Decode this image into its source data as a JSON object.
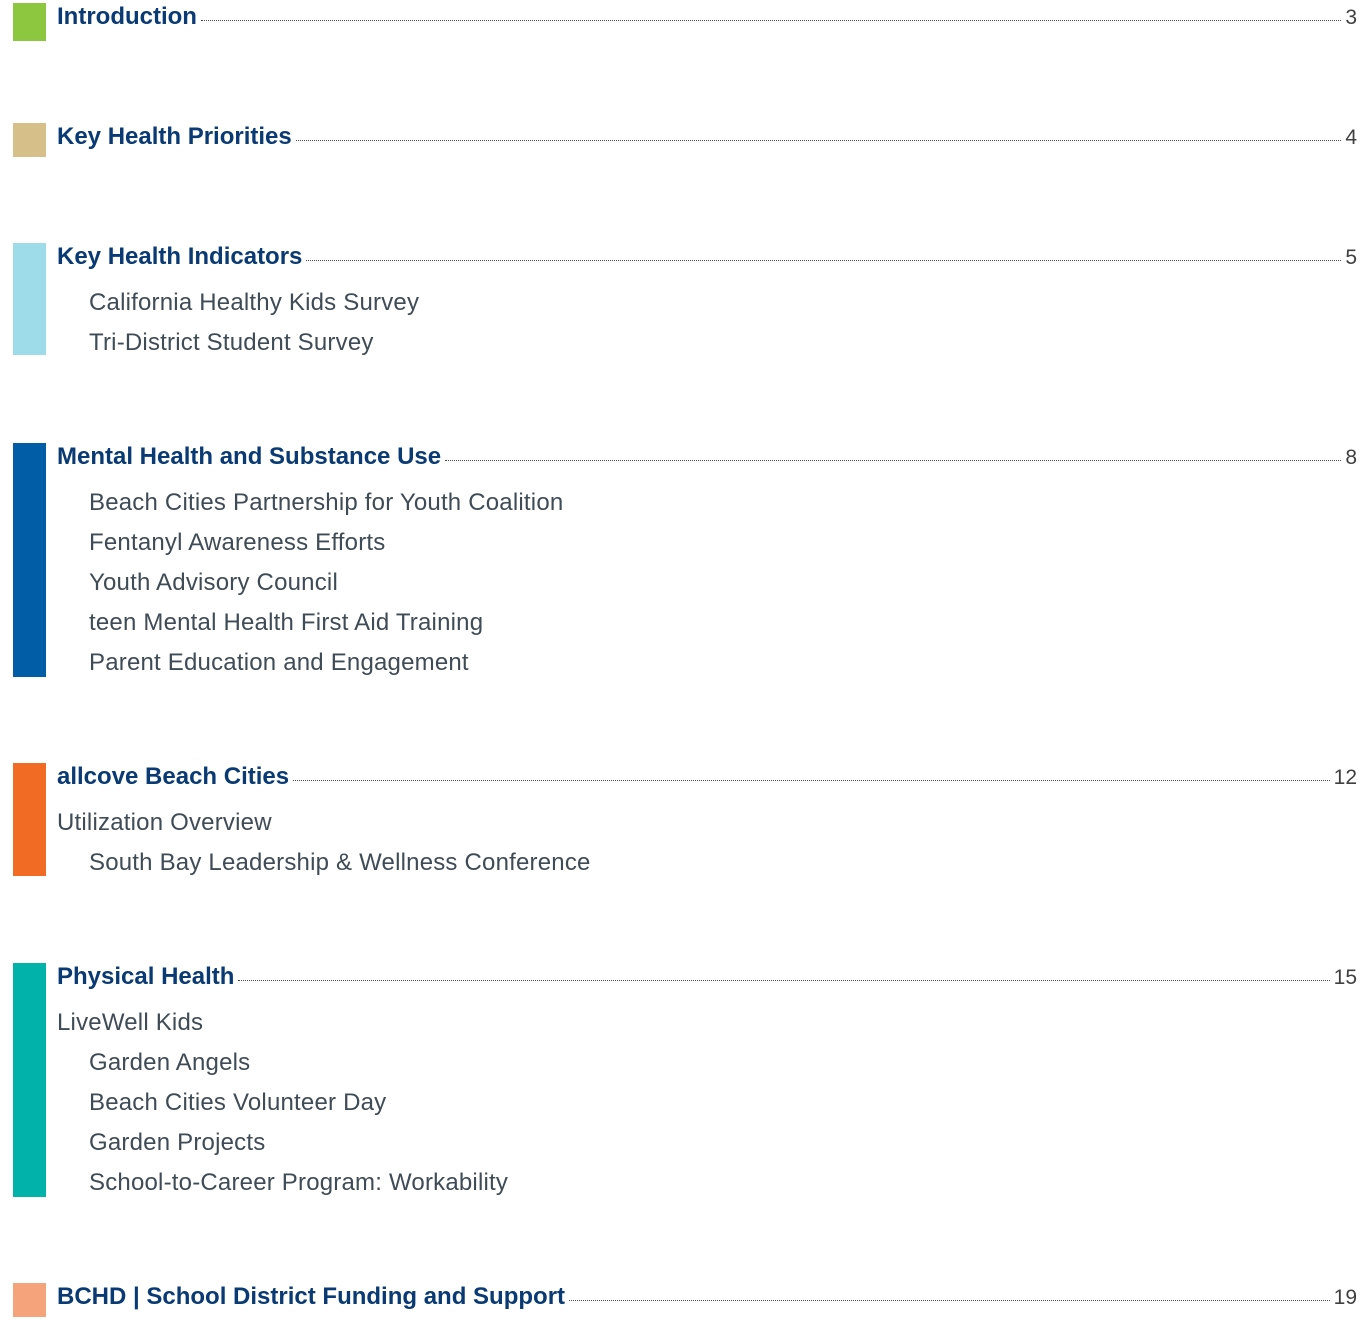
{
  "toc": {
    "sections": [
      {
        "title": "Introduction",
        "page": "3",
        "color": "#8dc63f",
        "items": []
      },
      {
        "title": "Key Health Priorities",
        "page": "4",
        "color": "#d7bf8a",
        "items": []
      },
      {
        "title": "Key Health Indicators",
        "page": "5",
        "color": "#9fdcea",
        "items": [
          {
            "label": "California Healthy Kids Survey",
            "indent": true
          },
          {
            "label": "Tri-District Student Survey",
            "indent": true
          }
        ]
      },
      {
        "title": "Mental Health and Substance Use",
        "page": "8",
        "color": "#005da6",
        "items": [
          {
            "label": "Beach Cities Partnership for Youth Coalition",
            "indent": true
          },
          {
            "label": "Fentanyl Awareness Efforts",
            "indent": true
          },
          {
            "label": "Youth Advisory Council",
            "indent": true
          },
          {
            "label": "teen Mental Health First Aid Training",
            "indent": true
          },
          {
            "label": "Parent Education and Engagement",
            "indent": true
          }
        ]
      },
      {
        "title": "allcove Beach Cities",
        "page": "12",
        "color": "#f26b24",
        "items": [
          {
            "label": "Utilization Overview",
            "indent": false
          },
          {
            "label": "South Bay Leadership & Wellness Conference",
            "indent": true
          }
        ]
      },
      {
        "title": "Physical Health",
        "page": "15",
        "color": "#00b2aa",
        "items": [
          {
            "label": "LiveWell Kids",
            "indent": false
          },
          {
            "label": "Garden Angels",
            "indent": true
          },
          {
            "label": "Beach Cities Volunteer Day",
            "indent": true
          },
          {
            "label": "Garden Projects",
            "indent": true
          },
          {
            "label": "School-to-Career Program: Workability",
            "indent": true
          }
        ]
      },
      {
        "title": "BCHD | School District Funding and Support",
        "page": "19",
        "color": "#f4a37b",
        "items": []
      }
    ]
  }
}
